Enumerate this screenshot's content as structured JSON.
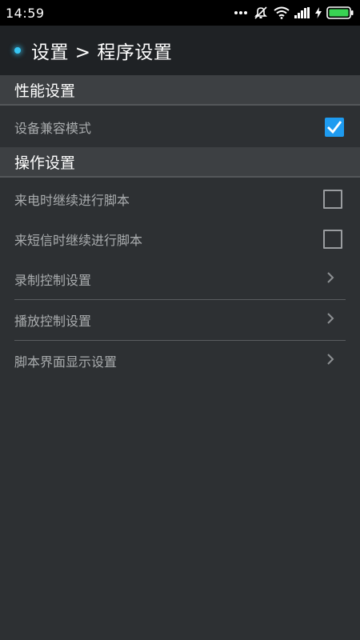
{
  "status_bar": {
    "time": "14:59",
    "icons": [
      "more-dots-icon",
      "muted-icon",
      "wifi-icon",
      "signal-icon",
      "charging-icon",
      "battery-icon"
    ]
  },
  "app_bar": {
    "title": "设置 > 程序设置"
  },
  "sections": {
    "performance": {
      "title": "性能设置",
      "items": [
        {
          "label": "设备兼容模式",
          "control": "checkbox",
          "checked": true
        }
      ]
    },
    "operation": {
      "title": "操作设置",
      "items": [
        {
          "label": "来电时继续进行脚本",
          "control": "checkbox",
          "checked": false
        },
        {
          "label": "来短信时继续进行脚本",
          "control": "checkbox",
          "checked": false
        },
        {
          "label": "录制控制设置",
          "control": "chevron"
        },
        {
          "label": "播放控制设置",
          "control": "chevron"
        },
        {
          "label": "脚本界面显示设置",
          "control": "chevron"
        }
      ]
    }
  },
  "colors": {
    "accent": "#1e9bf0",
    "indicator": "#36c6f4",
    "background": "#2d3033",
    "section_header": "#3d4043"
  }
}
